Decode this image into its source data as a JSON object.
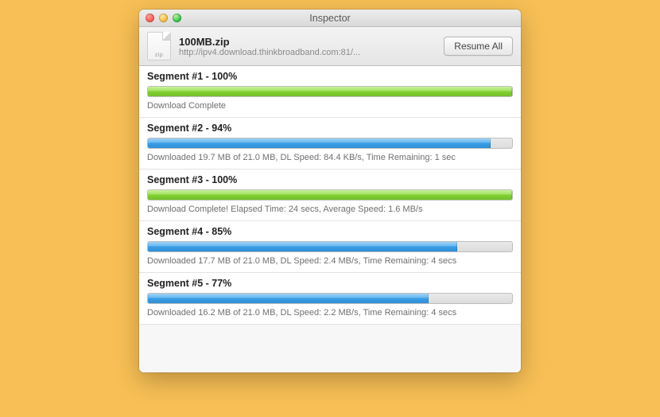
{
  "window": {
    "title": "Inspector"
  },
  "file": {
    "icon_ext": "zip",
    "name": "100MB.zip",
    "url": "http://ipv4.download.thinkbroadband.com:81/..."
  },
  "toolbar": {
    "resume_label": "Resume All"
  },
  "segments": [
    {
      "title": "Segment #1 - 100%",
      "percent": 100,
      "complete": true,
      "status": "Download Complete"
    },
    {
      "title": "Segment #2 - 94%",
      "percent": 94,
      "complete": false,
      "status": "Downloaded 19.7 MB of 21.0 MB, DL Speed: 84.4 KB/s, Time Remaining: 1 sec"
    },
    {
      "title": "Segment #3 - 100%",
      "percent": 100,
      "complete": true,
      "status": "Download Complete! Elapsed Time: 24 secs, Average Speed: 1.6 MB/s"
    },
    {
      "title": "Segment #4 - 85%",
      "percent": 85,
      "complete": false,
      "status": "Downloaded 17.7 MB of 21.0 MB, DL Speed: 2.4 MB/s, Time Remaining: 4 secs"
    },
    {
      "title": "Segment #5 - 77%",
      "percent": 77,
      "complete": false,
      "status": "Downloaded 16.2 MB of 21.0 MB, DL Speed: 2.2 MB/s, Time Remaining: 4 secs"
    }
  ]
}
